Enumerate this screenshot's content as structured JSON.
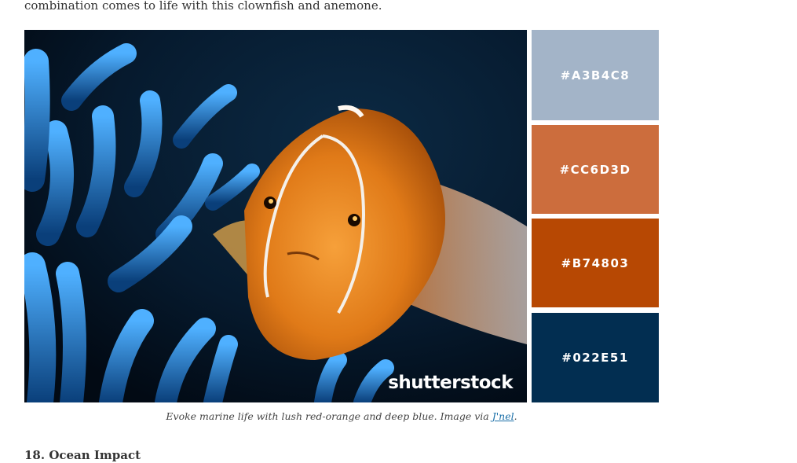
{
  "intro_text": "combination comes to life with this clownfish and anemone.",
  "photo": {
    "subject": "clownfish-and-anemone",
    "watermark": "shutterstock"
  },
  "swatches": [
    {
      "hex": "#A3B4C8",
      "color": "#A3B4C8"
    },
    {
      "hex": "#CC6D3D",
      "color": "#CC6D3D"
    },
    {
      "hex": "#B74803",
      "color": "#B74803"
    },
    {
      "hex": "#022E51",
      "color": "#022E51"
    }
  ],
  "caption": {
    "text": "Evoke marine life with lush red-orange and deep blue. Image via ",
    "link_text": "J'nel",
    "suffix": "."
  },
  "section_heading": "18. Ocean Impact"
}
